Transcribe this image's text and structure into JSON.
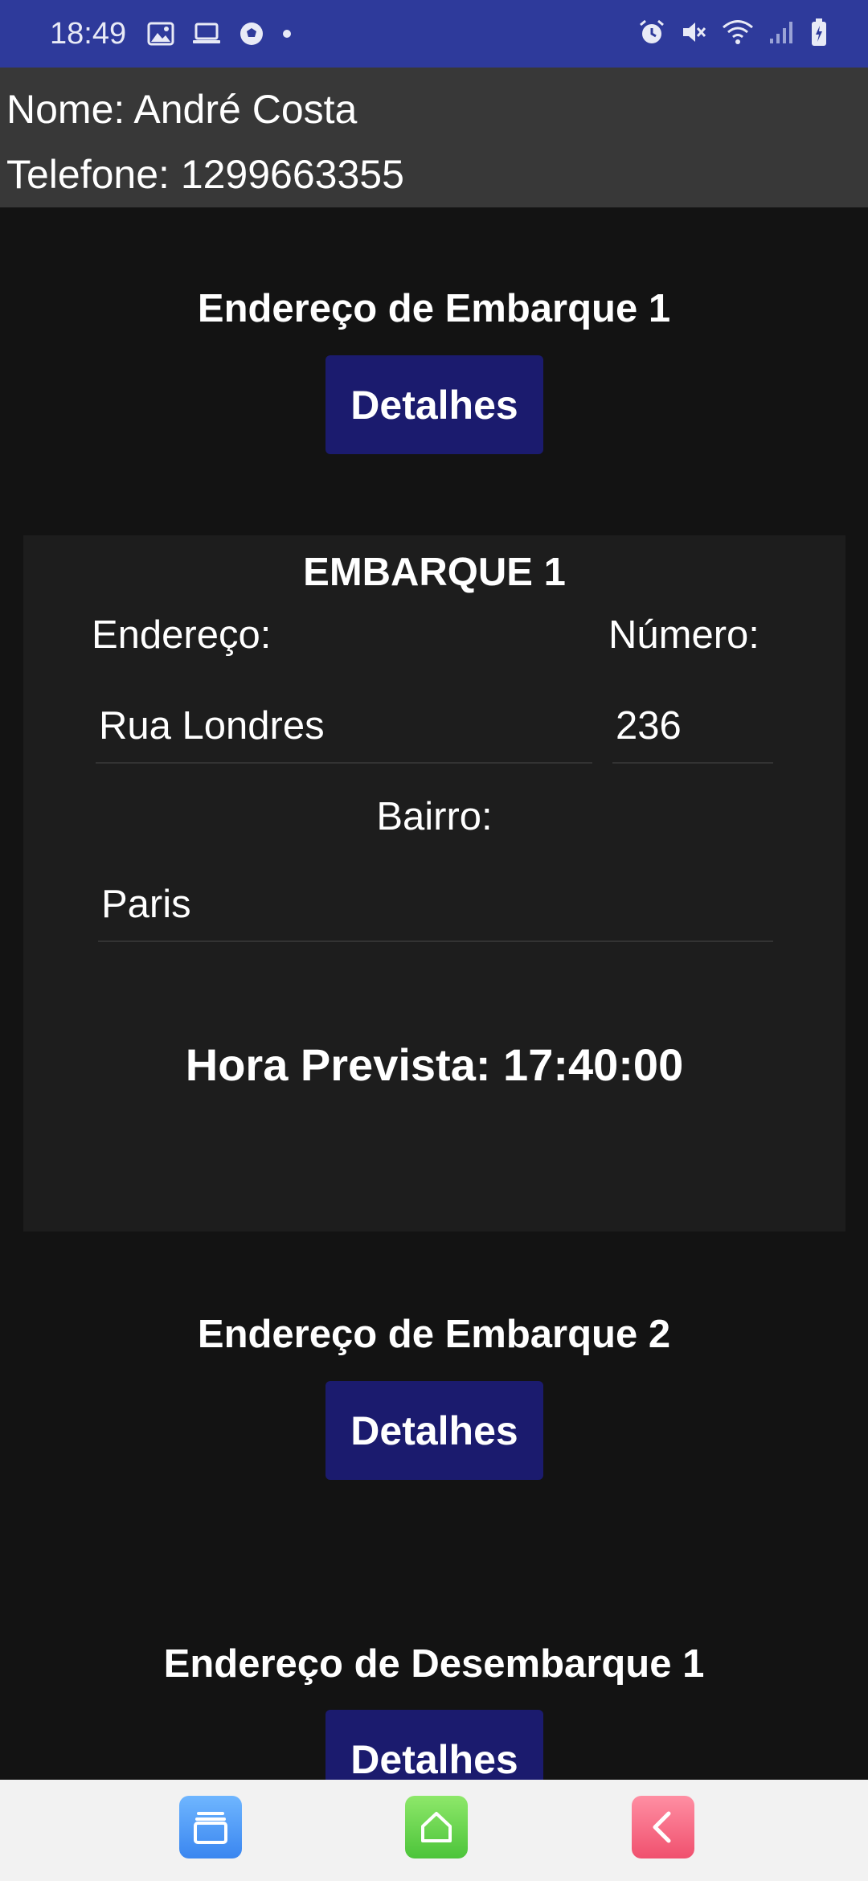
{
  "status_bar": {
    "time": "18:49",
    "left_icons": [
      "image-icon",
      "laptop-icon",
      "soccer-ball-icon",
      "dot-icon"
    ],
    "right_icons": [
      "alarm-icon",
      "mute-icon",
      "wifi-icon",
      "signal-icon",
      "battery-charging-icon"
    ],
    "background": "#2e3a9b"
  },
  "header": {
    "nome": "Nome: André Costa",
    "telefone": "Telefone: 1299663355"
  },
  "sections": {
    "embarque1_title": "Endereço de Embarque 1",
    "embarque1_button": "Detalhes",
    "embarque2_title": "Endereço de Embarque 2",
    "embarque2_button": "Detalhes",
    "desembarque1_title": "Endereço de Desembarque 1",
    "desembarque1_button": "Detalhes"
  },
  "card": {
    "title": "EMBARQUE 1",
    "endereco_label": "Endereço:",
    "endereco_value": "Rua Londres",
    "numero_label": "Número:",
    "numero_value": "236",
    "bairro_label": "Bairro:",
    "bairro_value": "Paris",
    "hora_prevista": "Hora Prevista: 17:40:00"
  },
  "colors": {
    "accent_button": "#1b1b6e",
    "header_bg": "#383838",
    "card_bg": "#1d1d1d",
    "page_bg": "#131313"
  },
  "nav_bar": {
    "buttons": [
      "recent-apps-icon",
      "home-icon",
      "back-icon"
    ]
  }
}
